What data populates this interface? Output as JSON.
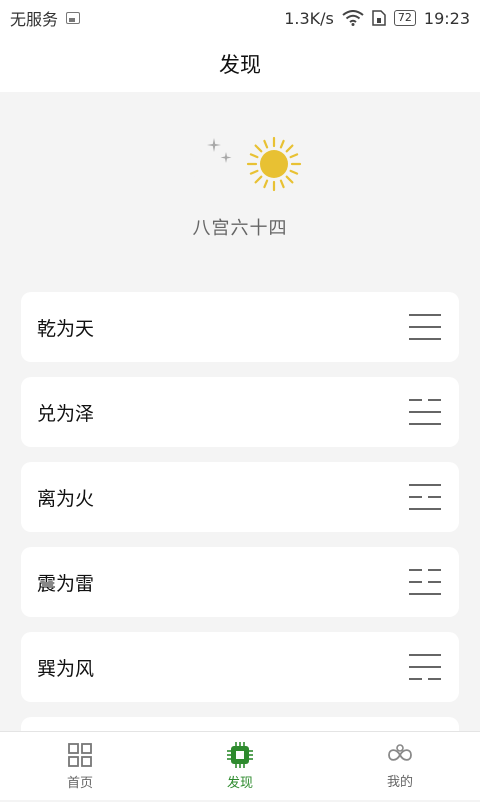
{
  "status_bar": {
    "carrier": "无服务",
    "speed": "1.3K/s",
    "battery": "72",
    "time": "19:23"
  },
  "header": {
    "title": "发现"
  },
  "hero": {
    "label": "八宫六十四",
    "moon_icon": "moon-stars-icon",
    "sun_icon": "sun-icon"
  },
  "palaces": [
    {
      "name": "乾为天",
      "trigram": [
        "solid",
        "solid",
        "solid"
      ]
    },
    {
      "name": "兑为泽",
      "trigram": [
        "broken",
        "solid",
        "solid"
      ]
    },
    {
      "name": "离为火",
      "trigram": [
        "solid",
        "broken",
        "solid"
      ]
    },
    {
      "name": "震为雷",
      "trigram": [
        "broken",
        "broken",
        "solid"
      ]
    },
    {
      "name": "巽为风",
      "trigram": [
        "solid",
        "solid",
        "broken"
      ]
    }
  ],
  "tabs": [
    {
      "label": "首页",
      "icon": "grid-icon",
      "active": false
    },
    {
      "label": "发现",
      "icon": "chip-icon",
      "active": true
    },
    {
      "label": "我的",
      "icon": "infinity-icon",
      "active": false
    }
  ],
  "colors": {
    "accent": "#2e8b2e",
    "sun": "#e8c133",
    "moon": "#a8a8a8"
  }
}
